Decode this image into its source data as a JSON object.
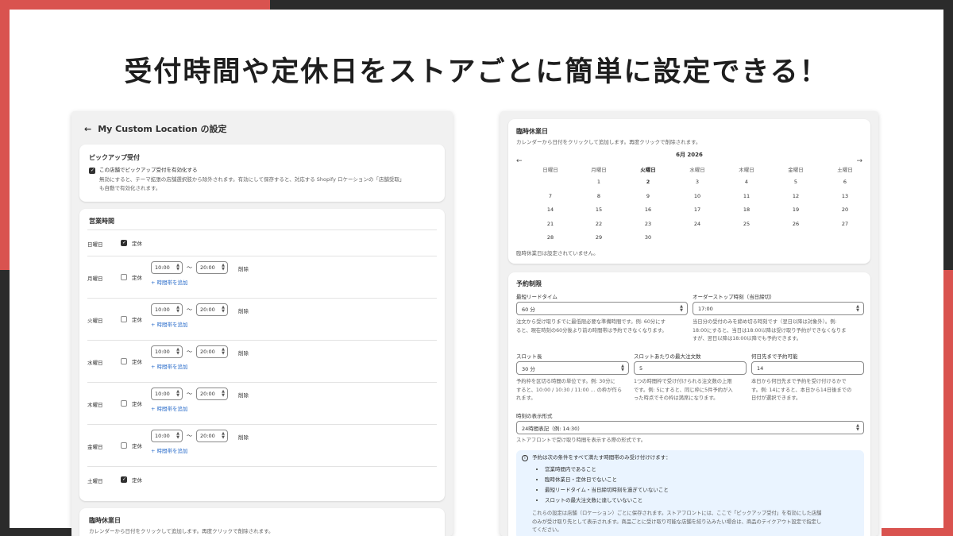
{
  "headline": "受付時間や定休日をストアごとに簡単に設定できる！",
  "left": {
    "title": "My Custom Location の設定",
    "pickup": {
      "title": "ピックアップ受付",
      "checkbox_label": "この店舗でピックアップ受付を有効化する",
      "checked": true,
      "help_line1": "無効にすると、テーマ拡張の店舗選択肢から除外されます。有効にして保存すると、対応する Shopify ロケーションの「店舗受取」",
      "help_line2": "も自動で有効化されます。"
    },
    "hours": {
      "title": "営業時間",
      "closed_label": "定休",
      "delete_label": "削除",
      "add_label": "+ 時間帯を追加",
      "tilde": "〜",
      "days": [
        {
          "day": "日曜日",
          "closed": true
        },
        {
          "day": "月曜日",
          "closed": false,
          "start": "10:00",
          "end": "20:00"
        },
        {
          "day": "火曜日",
          "closed": false,
          "start": "10:00",
          "end": "20:00"
        },
        {
          "day": "水曜日",
          "closed": false,
          "start": "10:00",
          "end": "20:00"
        },
        {
          "day": "木曜日",
          "closed": false,
          "start": "10:00",
          "end": "20:00"
        },
        {
          "day": "金曜日",
          "closed": false,
          "start": "10:00",
          "end": "20:00"
        },
        {
          "day": "土曜日",
          "closed": true
        }
      ]
    },
    "holidays": {
      "title": "臨時休業日",
      "help": "カレンダーから日付をクリックして追加します。再度クリックで削除されます。"
    }
  },
  "right": {
    "holidays": {
      "title": "臨時休業日",
      "help": "カレンダーから日付をクリックして追加します。再度クリックで削除されます。",
      "month": "6月 2026",
      "weekdays": [
        "日曜日",
        "月曜日",
        "火曜日",
        "水曜日",
        "木曜日",
        "金曜日",
        "土曜日"
      ],
      "weeks": [
        [
          "",
          "1",
          "2",
          "3",
          "4",
          "5",
          "6"
        ],
        [
          "7",
          "8",
          "9",
          "10",
          "11",
          "12",
          "13"
        ],
        [
          "14",
          "15",
          "16",
          "17",
          "18",
          "19",
          "20"
        ],
        [
          "21",
          "22",
          "23",
          "24",
          "25",
          "26",
          "27"
        ],
        [
          "28",
          "29",
          "30",
          "",
          "",
          "",
          ""
        ]
      ],
      "today_col": 2,
      "empty_text": "臨時休業日は設定されていません。"
    },
    "reservation": {
      "title": "予約制限",
      "lead_label": "最短リードタイム",
      "lead_value": "60 分",
      "lead_help": [
        "注文から受け取りまでに最低限必要な準備時間です。例: 60分にす",
        "ると、現在時刻の60分後より前の時間帯は予約できなくなります。"
      ],
      "cutoff_label": "オーダーストップ時刻（当日締切）",
      "cutoff_value": "17:00",
      "cutoff_help": [
        "当日分の受付のみを締め切る時刻です（翌日以降は対象外）。例:",
        "18:00にすると、当日は18:00以降は受け取り予約ができなくなりま",
        "すが、翌日以降は18:00以降でも予約できます。"
      ],
      "slot_label": "スロット長",
      "slot_value": "30 分",
      "slot_help": [
        "予約枠を区切る時間の単位です。例: 30分に",
        "すると、10:00 / 10:30 / 11:00 ... の枠が作ら",
        "れます。"
      ],
      "max_label": "スロットあたりの最大注文数",
      "max_value": "5",
      "max_help": [
        "1つの時間枠で受け付けられる注文数の上限",
        "です。例: 5にすると、同じ枠に5件予約が入",
        "った時点でその枠は満席になります。"
      ],
      "days_label": "何日先まで予約可能",
      "days_value": "14",
      "days_help": [
        "本日から何日先まで予約を受け付けるかで",
        "す。例: 14にすると、本日から14日後までの",
        "日付が選択できます。"
      ],
      "format_label": "時刻の表示形式",
      "format_value": "24時間表記（例: 14:30）",
      "format_help": "ストアフロントで受け取り時間を表示する際の形式です。",
      "info_title": "予約は次の条件をすべて満たす時間帯のみ受け付けけます：",
      "info_items": [
        "営業時間内であること",
        "臨時休業日・定休日でないこと",
        "最短リードタイム・当日締切時刻を過ぎていないこと",
        "スロットの最大注文数に達していないこと"
      ],
      "info_note": [
        "これらの設定は店舗（ロケーション）ごとに保存されます。ストアフロントには、ここで「ピックアップ受付」を有効にした店舗",
        "のみが受け取り先として表示されます。商品ごとに受け取り可能な店舗を絞り込みたい場合は、商品のテイクアウト設定で指定し",
        "てください。"
      ]
    }
  },
  "colors": {
    "accent_red": "#d9534f",
    "dark": "#2b2b2b",
    "link_blue": "#2c6ecb",
    "info_bg": "#eaf4ff"
  }
}
